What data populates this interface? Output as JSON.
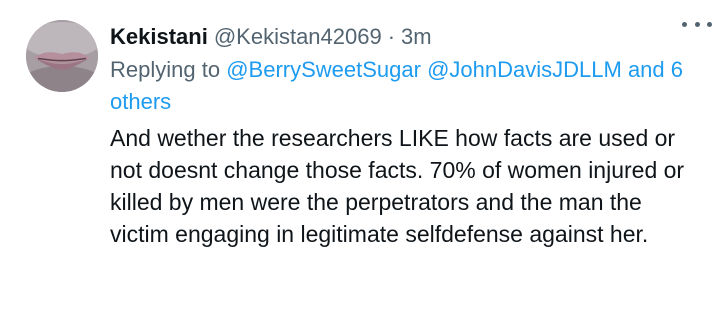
{
  "tweet": {
    "display_name": "Kekistani",
    "handle": "@Kekistan42069",
    "separator": "·",
    "time": "3m",
    "more_icon": "more-horizontal-icon",
    "replying_prefix": "Replying to",
    "mentions": [
      "@BerrySweetSugar",
      "@JohnDavisJDLLM"
    ],
    "others": "and 6 others",
    "text": "And wether the researchers LIKE how facts are used or not doesnt change those facts. 70% of women injured or killed by men were the perpetrators and the man the victim engaging in legitimate selfdefense against her."
  },
  "colors": {
    "text_primary": "#0f1419",
    "text_secondary": "#536471",
    "link": "#1d9bf0",
    "background": "#ffffff"
  }
}
